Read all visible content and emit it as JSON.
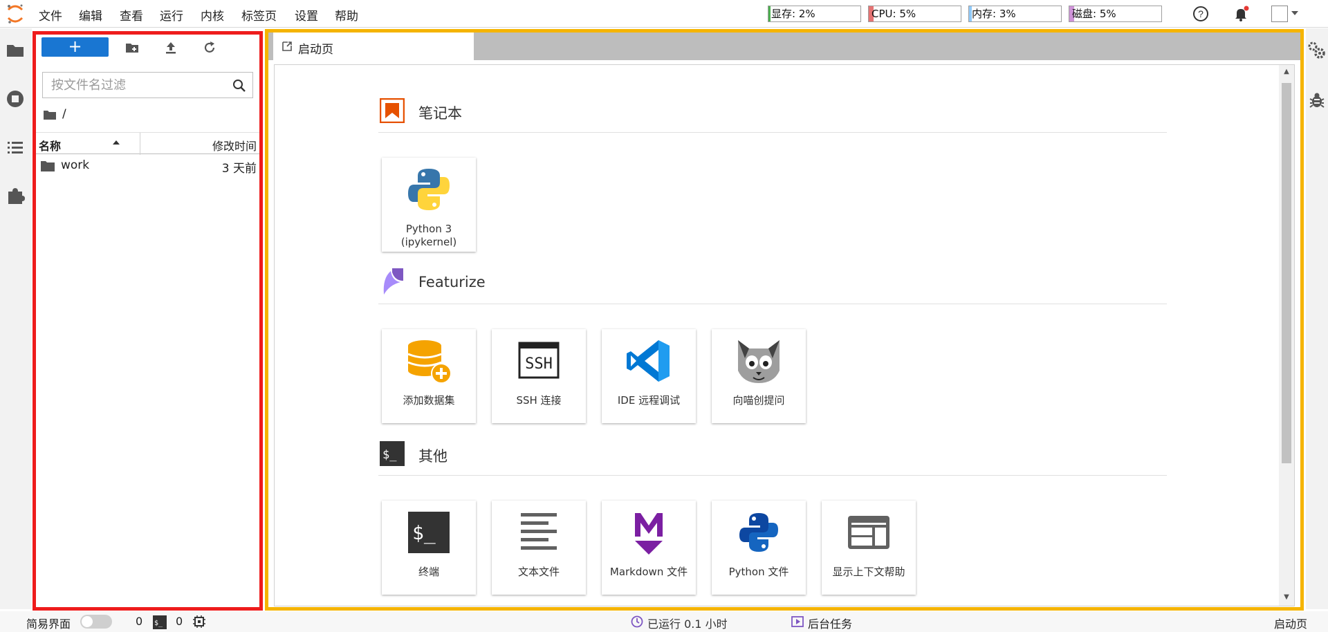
{
  "menu": {
    "items": [
      "文件",
      "编辑",
      "查看",
      "运行",
      "内核",
      "标签页",
      "设置",
      "帮助"
    ]
  },
  "meters": {
    "gpu": {
      "label": "显存: 2%",
      "value": 0.02,
      "color": "#4caf50"
    },
    "cpu": {
      "label": "CPU: 5%",
      "value": 0.05,
      "color": "#e57373"
    },
    "mem": {
      "label": "内存: 3%",
      "value": 0.03,
      "color": "#90caf9"
    },
    "disk": {
      "label": "磁盘: 5%",
      "value": 0.05,
      "color": "#ce93d8"
    }
  },
  "file_browser": {
    "new_label": "+",
    "filter_placeholder": "按文件名过滤",
    "path": "/",
    "col_name": "名称",
    "col_modified": "修改时间",
    "files": [
      {
        "name": "work",
        "modified": "3 天前",
        "type": "folder"
      }
    ]
  },
  "tabs": {
    "launcher": "启动页"
  },
  "launcher": {
    "notebook": {
      "title": "笔记本",
      "cards": [
        {
          "label": "Python 3 (ipykernel)",
          "icon": "python-icon"
        }
      ]
    },
    "featurize": {
      "title": "Featurize",
      "cards": [
        {
          "label": "添加数据集",
          "icon": "database-add-icon"
        },
        {
          "label": "SSH 连接",
          "icon": "ssh-icon"
        },
        {
          "label": "IDE 远程调试",
          "icon": "vscode-icon"
        },
        {
          "label": "向喵创提问",
          "icon": "cat-icon"
        }
      ]
    },
    "other": {
      "title": "其他",
      "cards": [
        {
          "label": "终端",
          "icon": "terminal-icon"
        },
        {
          "label": "文本文件",
          "icon": "text-file-icon"
        },
        {
          "label": "Markdown 文件",
          "icon": "markdown-icon"
        },
        {
          "label": "Python 文件",
          "icon": "python-file-icon"
        },
        {
          "label": "显示上下文帮助",
          "icon": "context-help-icon"
        }
      ]
    }
  },
  "statusbar": {
    "simple_mode": "简易界面",
    "kernels_count": "0",
    "terminals_count": "0",
    "runtime": "已运行 0.1 小时",
    "background_tasks": "后台任务",
    "current_tab": "启动页"
  },
  "colors": {
    "new_button": "#1976d2",
    "panel_border": "#ee1c1c",
    "main_border": "#f5b400",
    "notification_dot": "#e53935"
  }
}
